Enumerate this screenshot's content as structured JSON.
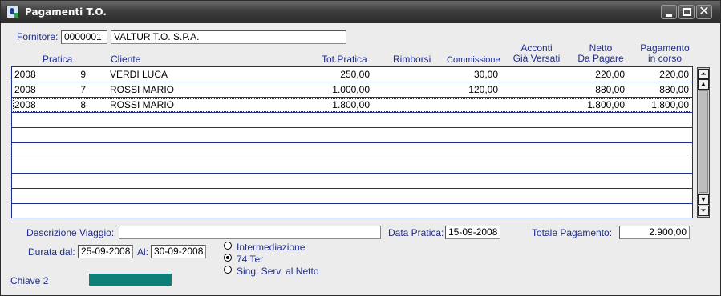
{
  "window": {
    "title": "Pagamenti T.O."
  },
  "supplier": {
    "label": "Fornitore:",
    "code": "0000001",
    "name": "VALTUR T.O. S.P.A."
  },
  "columns": {
    "pratica": "Pratica",
    "cliente": "Cliente",
    "tot_pratica": "Tot.Pratica",
    "rimborsi": "Rimborsi",
    "commissione": "Commissione",
    "acconti_1": "Acconti",
    "acconti_2": "Già Versati",
    "netto_1": "Netto",
    "netto_2": "Da Pagare",
    "pagamento_1": "Pagamento",
    "pagamento_2": "in corso"
  },
  "rows": [
    {
      "anno": "2008",
      "pratica": "9",
      "cliente": "VERDI LUCA",
      "tot_pratica": "250,00",
      "rimborsi": "",
      "commissione": "30,00",
      "acconti": "",
      "netto": "220,00",
      "pagamento": "220,00"
    },
    {
      "anno": "2008",
      "pratica": "7",
      "cliente": "ROSSI MARIO",
      "tot_pratica": "1.000,00",
      "rimborsi": "",
      "commissione": "120,00",
      "acconti": "",
      "netto": "880,00",
      "pagamento": "880,00"
    },
    {
      "anno": "2008",
      "pratica": "8",
      "cliente": "ROSSI MARIO",
      "tot_pratica": "1.800,00",
      "rimborsi": "",
      "commissione": "",
      "acconti": "",
      "netto": "1.800,00",
      "pagamento": "1.800,00"
    }
  ],
  "footer": {
    "descrizione_label": "Descrizione Viaggio:",
    "descrizione_value": "",
    "data_pratica_label": "Data Pratica:",
    "data_pratica_value": "15-09-2008",
    "totale_label": "Totale Pagamento:",
    "totale_value": "2.900,00",
    "durata_label": "Durata dal:",
    "durata_dal": "25-09-2008",
    "al_label": "Al:",
    "durata_al": "30-09-2008",
    "regime_options": [
      {
        "label": "Intermediazione",
        "selected": false
      },
      {
        "label": "74 Ter",
        "selected": true
      },
      {
        "label": "Sing. Serv. al Netto",
        "selected": false
      }
    ],
    "chiave_label": "Chiave 2"
  },
  "colors": {
    "label_blue": "#1f2d8c",
    "teal_bar": "#0d7f78"
  },
  "icons": {
    "window": "app-icon",
    "minimize": "minimize-icon",
    "maximize": "maximize-icon",
    "close": "close-icon",
    "scroll_top": "scroll-top-icon",
    "scroll_up": "scroll-up-icon",
    "scroll_down": "scroll-down-icon",
    "scroll_bottom": "scroll-bottom-icon"
  }
}
